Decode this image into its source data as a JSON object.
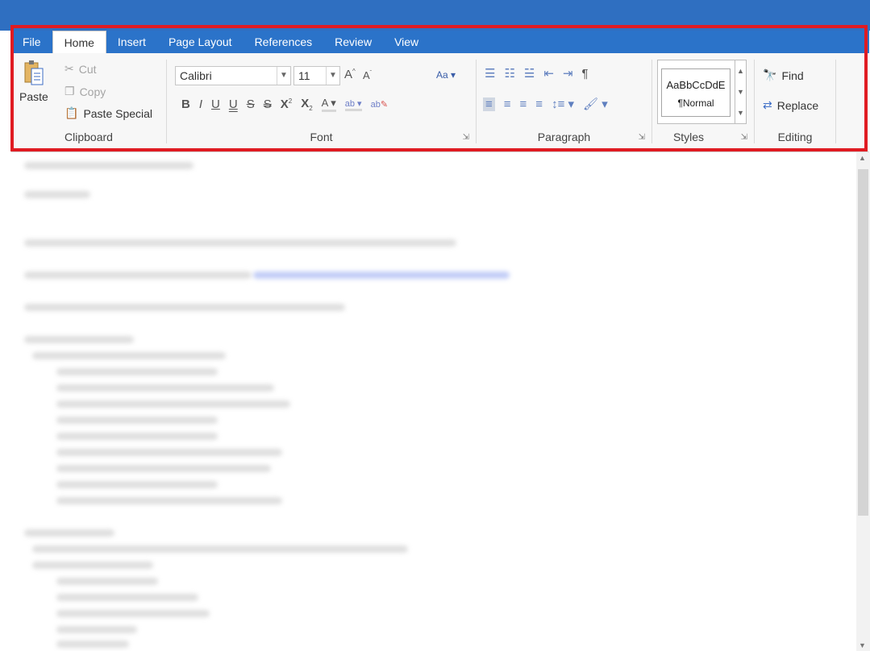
{
  "tabs": {
    "file": "File",
    "home": "Home",
    "insert": "Insert",
    "page_layout": "Page Layout",
    "references": "References",
    "review": "Review",
    "view": "View"
  },
  "clipboard": {
    "paste": "Paste",
    "cut": "Cut",
    "copy": "Copy",
    "paste_special": "Paste Special",
    "label": "Clipboard"
  },
  "font": {
    "family": "Calibri",
    "size": "11",
    "label": "Font"
  },
  "paragraph": {
    "label": "Paragraph"
  },
  "styles": {
    "sample": "AaBbCcDdE",
    "normal": "¶Normal",
    "label": "Styles"
  },
  "editing": {
    "find": "Find",
    "replace": "Replace",
    "label": "Editing"
  },
  "colors": {
    "title_bar": "#2f6fc1",
    "tab_bar": "#2b73c9",
    "highlight": "#e01b22"
  }
}
